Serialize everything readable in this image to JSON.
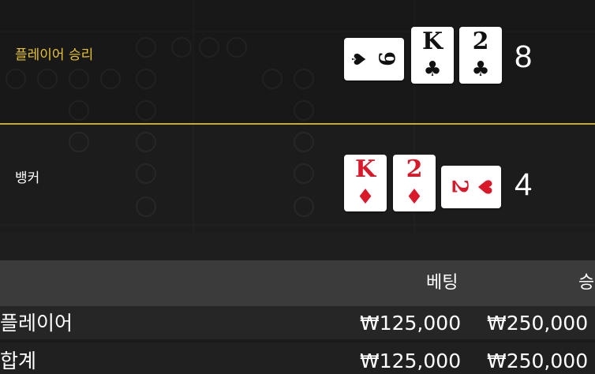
{
  "player_hand": {
    "label": "플레이어 승리",
    "score": "8",
    "cards": [
      {
        "rank": "9",
        "suit": "♠",
        "color": "black",
        "orientation": "sideways"
      },
      {
        "rank": "K",
        "suit": "♣",
        "color": "black",
        "orientation": "upright"
      },
      {
        "rank": "2",
        "suit": "♣",
        "color": "black",
        "orientation": "upright"
      }
    ]
  },
  "banker_hand": {
    "label": "뱅커",
    "score": "4",
    "cards": [
      {
        "rank": "K",
        "suit": "♦",
        "color": "red",
        "orientation": "upright"
      },
      {
        "rank": "2",
        "suit": "♦",
        "color": "red",
        "orientation": "upright"
      },
      {
        "rank": "2",
        "suit": "♥",
        "color": "red",
        "orientation": "sideways"
      }
    ]
  },
  "colors": {
    "win_label": "#e4c233",
    "divider": "#c7a93a",
    "red_suit": "#d9182a"
  },
  "results_table": {
    "headers": {
      "bet": "베팅",
      "win": "승"
    },
    "rows": [
      {
        "label": "플레이어",
        "bet": "₩125,000",
        "win": "₩250,000"
      },
      {
        "label": "합계",
        "bet": "₩125,000",
        "win": "₩250,000"
      }
    ]
  }
}
